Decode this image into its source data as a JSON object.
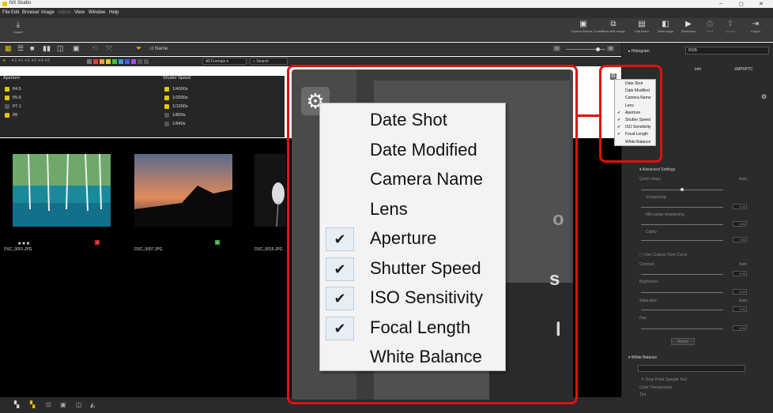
{
  "app": {
    "title": "NX Studio",
    "window_controls": [
      "–",
      "◻",
      "✕"
    ]
  },
  "menu": {
    "items": [
      {
        "label": "File",
        "enabled": true
      },
      {
        "label": "Edit",
        "enabled": true
      },
      {
        "label": "Browser",
        "enabled": true
      },
      {
        "label": "Image",
        "enabled": true
      },
      {
        "label": "Adjust",
        "enabled": false
      },
      {
        "label": "View",
        "enabled": true
      },
      {
        "label": "Window",
        "enabled": true
      },
      {
        "label": "Help",
        "enabled": true
      }
    ]
  },
  "toolbar": {
    "import_label": "Import",
    "tools": [
      {
        "label": "Custom Picture\nControl",
        "icon": "picture-control-icon"
      },
      {
        "label": "Pixel shift merge",
        "icon": "pixel-shift-icon"
      },
      {
        "label": "Edit Video",
        "icon": "edit-video-icon"
      },
      {
        "label": "Other Apps",
        "icon": "other-apps-icon"
      },
      {
        "label": "Slideshow",
        "icon": "slideshow-icon"
      },
      {
        "label": "Print",
        "icon": "print-icon"
      },
      {
        "label": "Upload",
        "icon": "upload-icon"
      },
      {
        "label": "Export",
        "icon": "export-icon"
      }
    ]
  },
  "viewbar": {
    "sort_label": "↓≡ Name"
  },
  "filterbar": {
    "ratings": "✦2 ✦1 ✦2 ✦3 ✦4 ✦5",
    "format_select": "All Formats",
    "search_placeholder": "Search",
    "label_colors": [
      "#777777",
      "#e33b3b",
      "#e9a23b",
      "#d8d22b",
      "#4bbd4b",
      "#3b9be3",
      "#4b5be3",
      "#b04be3",
      "#555555",
      "#555555"
    ]
  },
  "filter_panel": {
    "aperture": {
      "header": "Aperture",
      "items": [
        {
          "label": "f/4.5",
          "checked": true
        },
        {
          "label": "f/5.6",
          "checked": true
        },
        {
          "label": "f/7.1",
          "checked": false
        },
        {
          "label": "f/8",
          "checked": true
        }
      ]
    },
    "shutter": {
      "header": "Shutter Speed",
      "items": [
        {
          "label": "1/4000s",
          "checked": true
        },
        {
          "label": "1/2000s",
          "checked": true
        },
        {
          "label": "1/1000s",
          "checked": true
        },
        {
          "label": "1/800s",
          "checked": false
        },
        {
          "label": "1/640s",
          "checked": false
        }
      ]
    }
  },
  "thumbnails": [
    {
      "filename": "DSC_0001.JPG",
      "stars": "★★★",
      "label_color": "#d02020"
    },
    {
      "filename": "DSC_0007.JPG",
      "stars": "",
      "label_color": "#3ba83b"
    },
    {
      "filename": "DSC_0015.JPG",
      "stars": "",
      "label_color": ""
    }
  ],
  "right_panel": {
    "histogram_label": "Histogram",
    "histogram_mode": "RGB",
    "tabs": [
      "Info",
      "XMP/IPTC"
    ],
    "advanced_settings": "Advanced Settings",
    "quick_sharp": "Quick sharp",
    "sharpening": "Sharpening",
    "mid_range": "Mid-range sharpening",
    "clarity": "Clarity",
    "use_custom_tone": "Use Custom Tone Curve",
    "contrast": "Contrast",
    "brightness": "Brightness",
    "saturation": "Saturation",
    "hue": "Hue",
    "auto": "Auto",
    "reset": "Reset",
    "white_balance": "White Balance",
    "gray_point": "Gray Point Sample Tool",
    "color_temp": "Color Temperature",
    "val_zero": "0.00",
    "tint": "Tint"
  },
  "column_menu": {
    "items": [
      {
        "label": "Date Shot",
        "checked": false
      },
      {
        "label": "Date Modified",
        "checked": false
      },
      {
        "label": "Camera Name",
        "checked": false
      },
      {
        "label": "Lens",
        "checked": false
      },
      {
        "label": "Aperture",
        "checked": true
      },
      {
        "label": "Shutter Speed",
        "checked": true
      },
      {
        "label": "ISO Sensitivity",
        "checked": true
      },
      {
        "label": "Focal Length",
        "checked": true
      },
      {
        "label": "White Balance",
        "checked": false
      }
    ],
    "check_glyph": "✔"
  },
  "highlight_color": "#e01010"
}
